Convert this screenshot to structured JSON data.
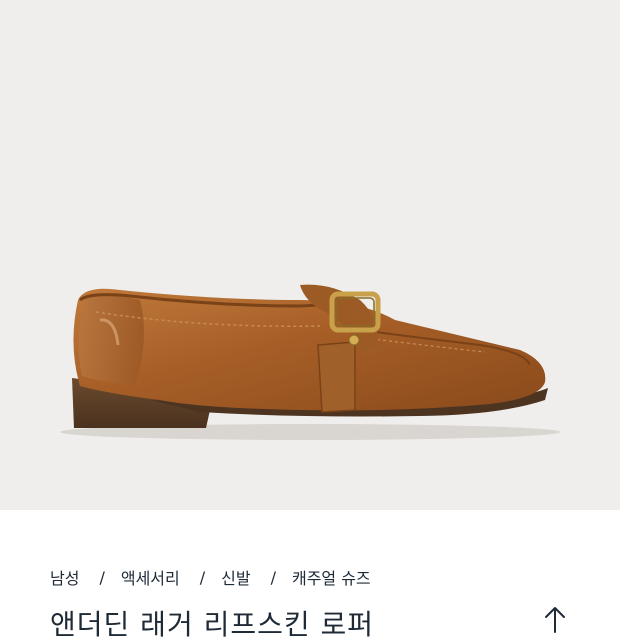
{
  "product": {
    "image_icon": "loafer-shoe-icon",
    "title": "앤더딘 래거 리프스킨 로퍼"
  },
  "breadcrumb": {
    "items": [
      {
        "label": "남성"
      },
      {
        "label": "액세서리"
      },
      {
        "label": "신발"
      },
      {
        "label": "캐주얼 슈즈"
      }
    ],
    "separator": "/"
  },
  "controls": {
    "scroll_top_icon": "arrow-up-icon"
  },
  "colors": {
    "hero_background": "#efeeec",
    "leather": "#a5622a",
    "text": "#1f2a37"
  }
}
